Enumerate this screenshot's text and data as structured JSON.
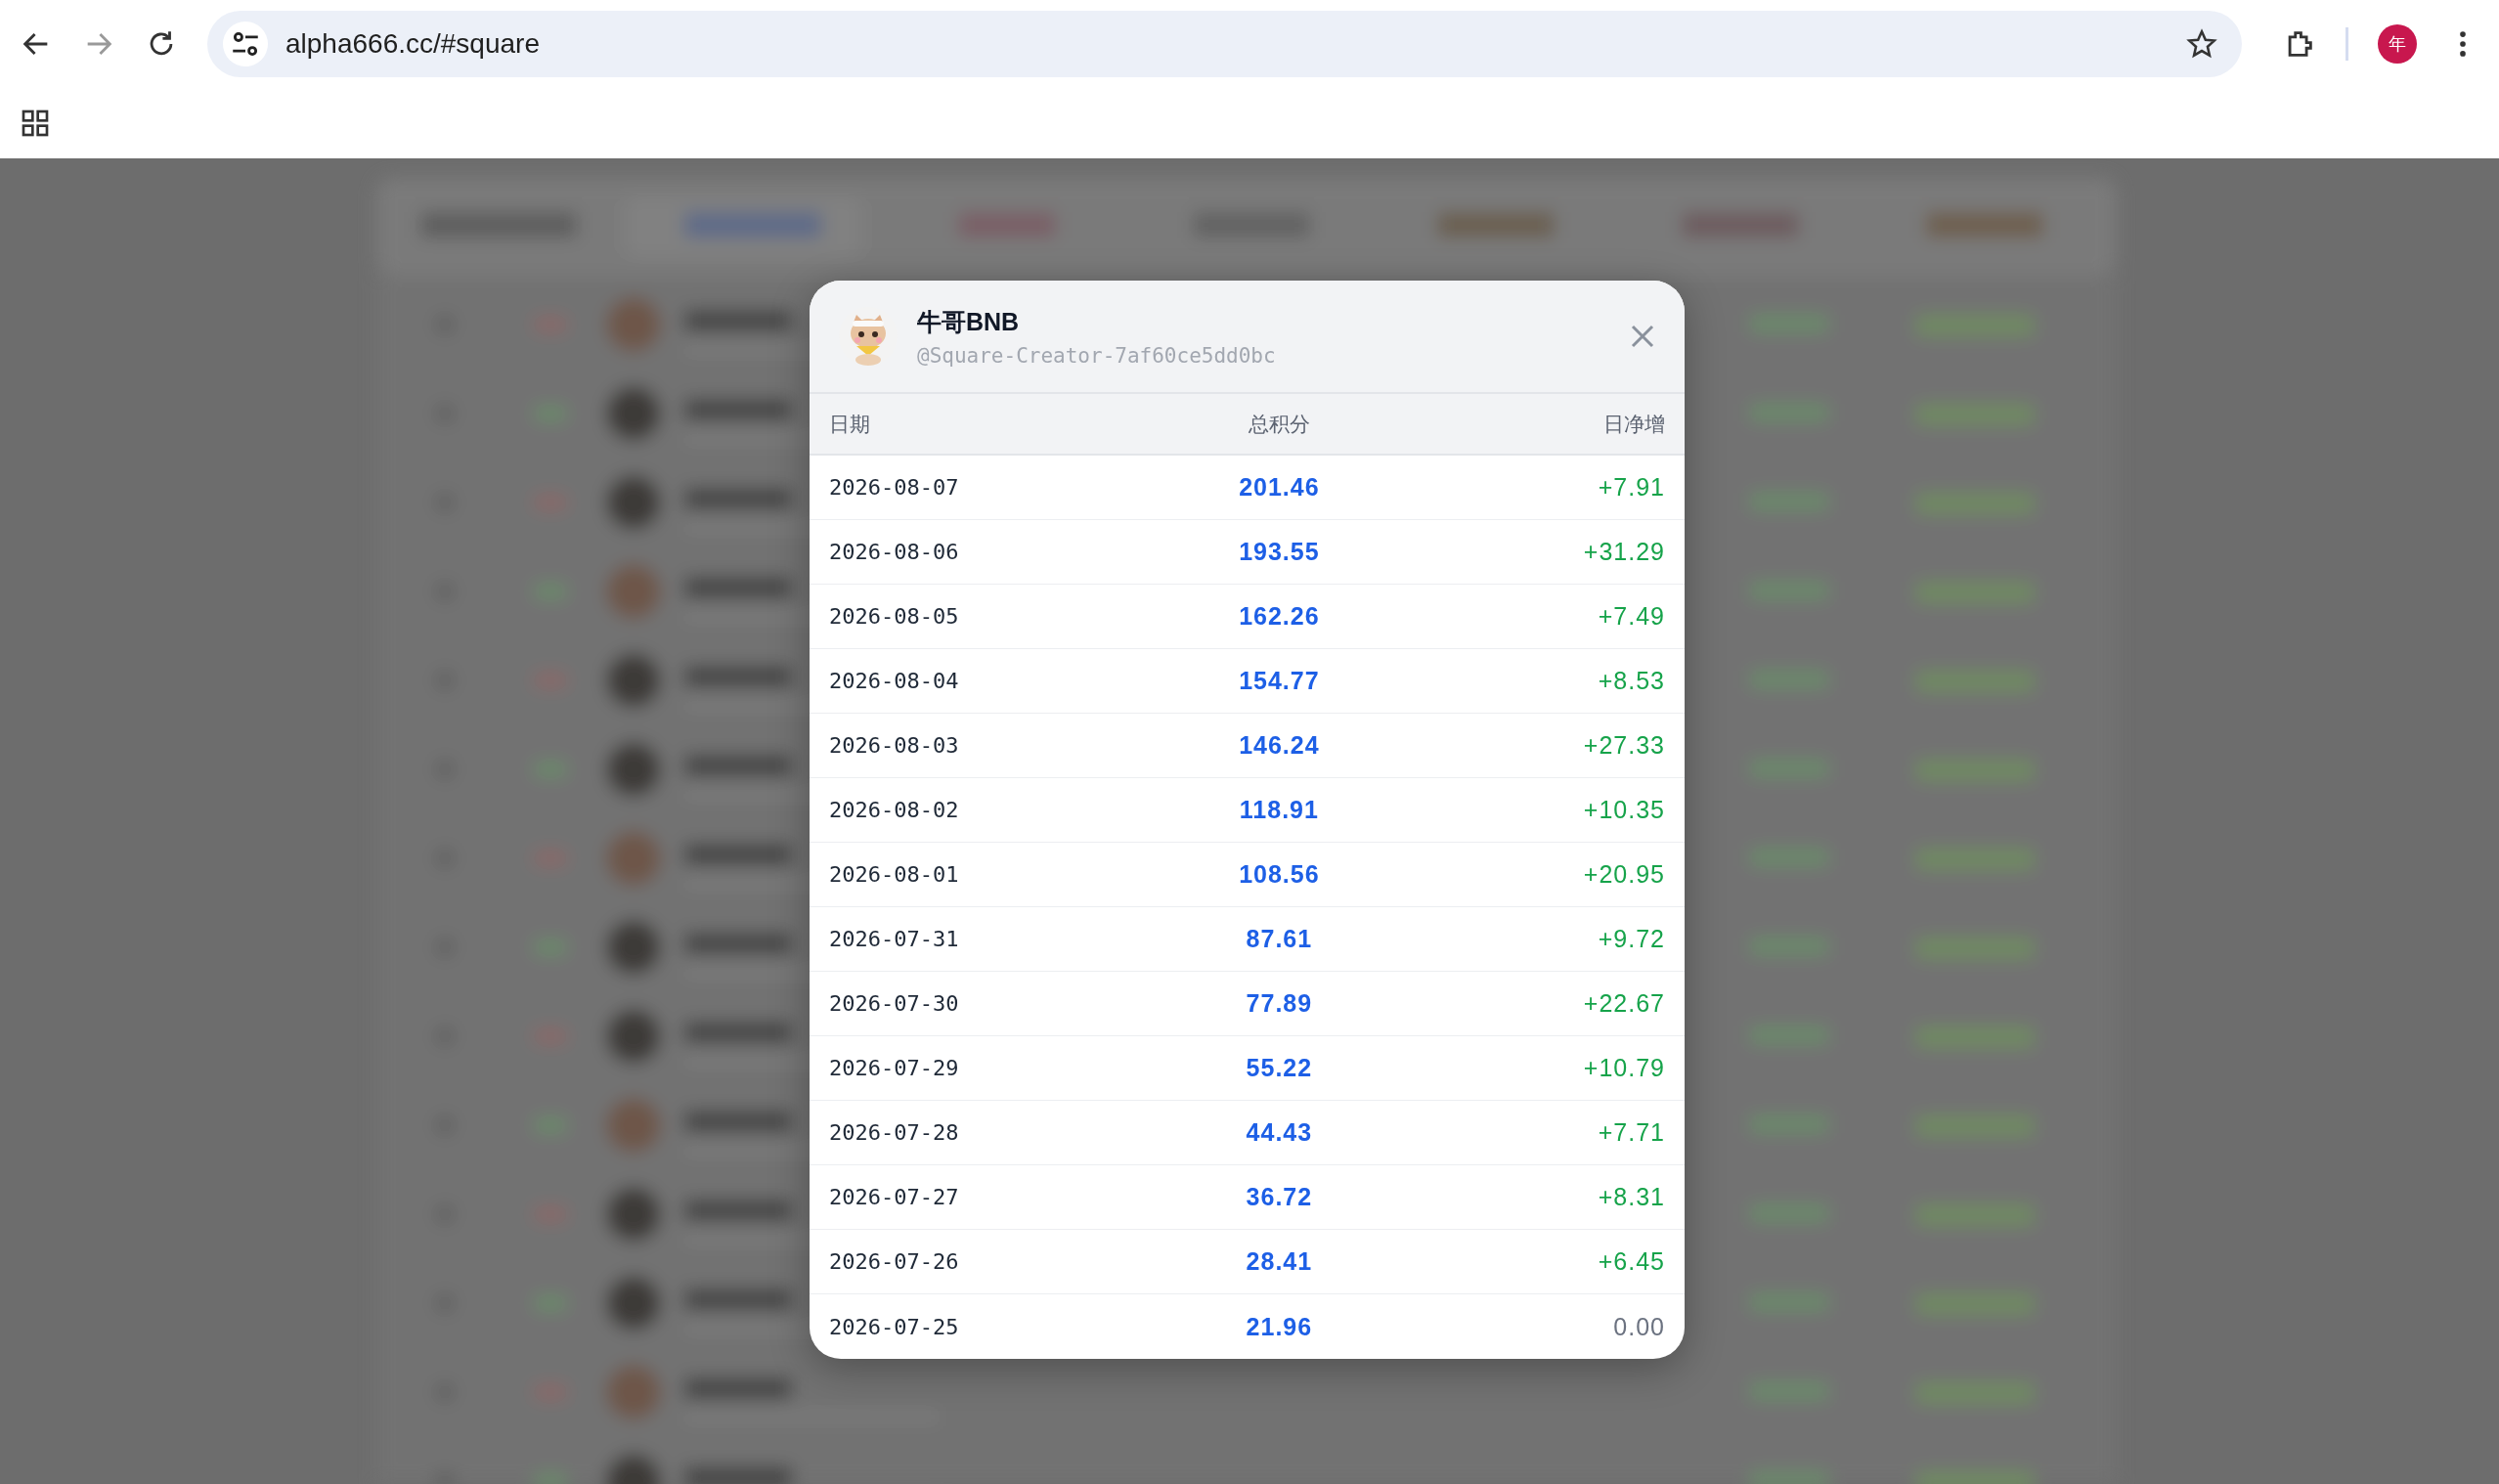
{
  "browser": {
    "url": "alpha666.cc/#square",
    "profile": "年"
  },
  "modal": {
    "name": "牛哥BNB",
    "handle": "@Square-Creator-7af60ce5dd0bc",
    "columns": [
      "日期",
      "总积分",
      "日净增"
    ],
    "rows": [
      {
        "date": "2026-08-07",
        "total": "201.46",
        "net": "+7.91",
        "kind": "gain"
      },
      {
        "date": "2026-08-06",
        "total": "193.55",
        "net": "+31.29",
        "kind": "gain"
      },
      {
        "date": "2026-08-05",
        "total": "162.26",
        "net": "+7.49",
        "kind": "gain"
      },
      {
        "date": "2026-08-04",
        "total": "154.77",
        "net": "+8.53",
        "kind": "gain"
      },
      {
        "date": "2026-08-03",
        "total": "146.24",
        "net": "+27.33",
        "kind": "gain"
      },
      {
        "date": "2026-08-02",
        "total": "118.91",
        "net": "+10.35",
        "kind": "gain"
      },
      {
        "date": "2026-08-01",
        "total": "108.56",
        "net": "+20.95",
        "kind": "gain"
      },
      {
        "date": "2026-07-31",
        "total": "87.61",
        "net": "+9.72",
        "kind": "gain"
      },
      {
        "date": "2026-07-30",
        "total": "77.89",
        "net": "+22.67",
        "kind": "gain"
      },
      {
        "date": "2026-07-29",
        "total": "55.22",
        "net": "+10.79",
        "kind": "gain"
      },
      {
        "date": "2026-07-28",
        "total": "44.43",
        "net": "+7.71",
        "kind": "gain"
      },
      {
        "date": "2026-07-27",
        "total": "36.72",
        "net": "+8.31",
        "kind": "gain"
      },
      {
        "date": "2026-07-26",
        "total": "28.41",
        "net": "+6.45",
        "kind": "gain"
      },
      {
        "date": "2026-07-25",
        "total": "21.96",
        "net": "0.00",
        "kind": "flat"
      }
    ]
  }
}
